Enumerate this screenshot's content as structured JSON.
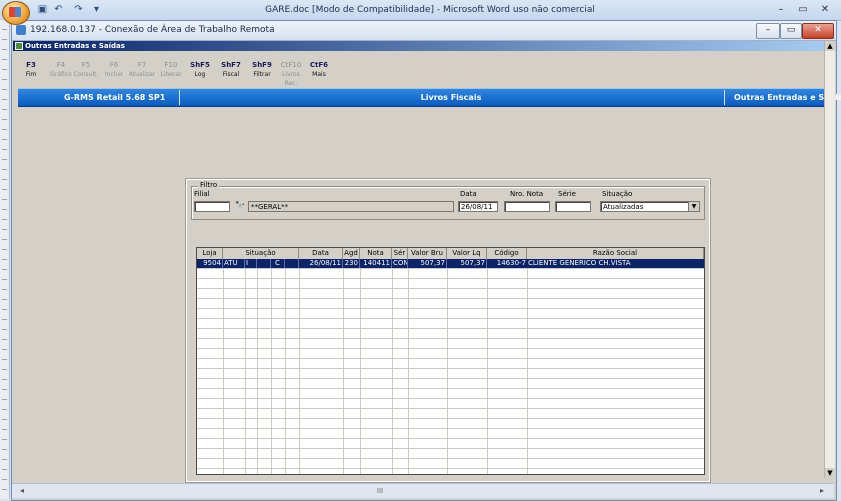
{
  "word": {
    "title": "GARE.doc [Modo de Compatibilidade] - Microsoft Word uso não comercial",
    "qat": [
      "save-icon",
      "undo-icon",
      "redo-icon",
      "customize-icon"
    ],
    "controls": [
      "–",
      "▭",
      "✕"
    ]
  },
  "remote": {
    "title": "192.168.0.137 - Conexão de Área de Trabalho Remota",
    "controls": [
      "–",
      "▭",
      "✕"
    ]
  },
  "app": {
    "window_title": "Outras Entradas e Saídas",
    "toolbar": [
      {
        "key": "F3",
        "label": "Fim",
        "enabled": true
      },
      {
        "key": "F4",
        "label": "Gráfico",
        "enabled": false
      },
      {
        "key": "F5",
        "label": "Consult.",
        "enabled": false
      },
      {
        "key": "F6",
        "label": "Incluir",
        "enabled": false
      },
      {
        "key": "F7",
        "label": "Atualizar",
        "enabled": false
      },
      {
        "key": "F10",
        "label": "Liberar",
        "enabled": false
      },
      {
        "key": "ShF5",
        "label": "Log",
        "enabled": true
      },
      {
        "key": "ShF7",
        "label": "Fiscal",
        "enabled": true
      },
      {
        "key": "ShF9",
        "label": "Filtrar",
        "enabled": true
      },
      {
        "key": "CtF10",
        "label": "Livros Rec.",
        "enabled": false
      },
      {
        "key": "CtF6",
        "label": "Mais",
        "enabled": true
      }
    ],
    "strip": {
      "left": "G-RMS Retail 5.68 SP1",
      "center": "Livros Fiscais",
      "right": "Outras Entradas e Saídas"
    },
    "filter": {
      "legend": "Filtro",
      "filial_label": "Filial",
      "filial_value": "",
      "filial_desc": "**GERAL**",
      "data_label": "Data",
      "data_value": "26/08/11",
      "nro_nota_label": "Nro. Nota",
      "nro_nota_value": "",
      "serie_label": "Série",
      "serie_value": "",
      "situacao_label": "Situação",
      "situacao_value": "Atualizadas"
    },
    "grid": {
      "columns": [
        "Loja",
        "Situação",
        "",
        "",
        "",
        "Data",
        "Agd",
        "Nota",
        "Sér",
        "Valor Bru",
        "Valor Lq",
        "Código",
        "Razão Social"
      ],
      "rows": [
        [
          "9504",
          "ATU",
          "I",
          "",
          "C",
          "26/08/11",
          "230",
          "140411",
          "CON",
          "507,37",
          "507,37",
          "14630-7",
          "CLIENTE GENERICO CH.VISTA"
        ]
      ]
    }
  }
}
